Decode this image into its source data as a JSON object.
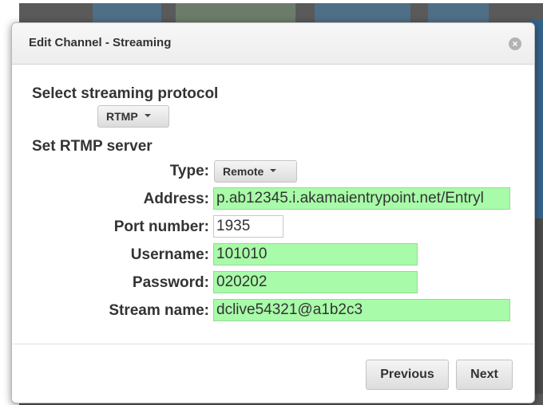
{
  "dialog": {
    "title": "Edit Channel - Streaming",
    "close_icon": "close-icon"
  },
  "protocol": {
    "heading": "Select streaming protocol",
    "selected": "RTMP"
  },
  "server": {
    "heading": "Set RTMP server",
    "type_label": "Type:",
    "type_selected": "Remote",
    "address_label": "Address:",
    "address_value": "p.ab12345.i.akamaientrypoint.net/Entryl",
    "port_label": "Port number:",
    "port_value": "1935",
    "username_label": "Username:",
    "username_value": "101010",
    "password_label": "Password:",
    "password_value": "020202",
    "stream_label": "Stream name:",
    "stream_value": "dclive54321@a1b2c3"
  },
  "footer": {
    "previous_label": "Previous",
    "next_label": "Next"
  },
  "colors": {
    "filled_field": "#a8fba8",
    "header_bg": "#f2f2f2"
  }
}
